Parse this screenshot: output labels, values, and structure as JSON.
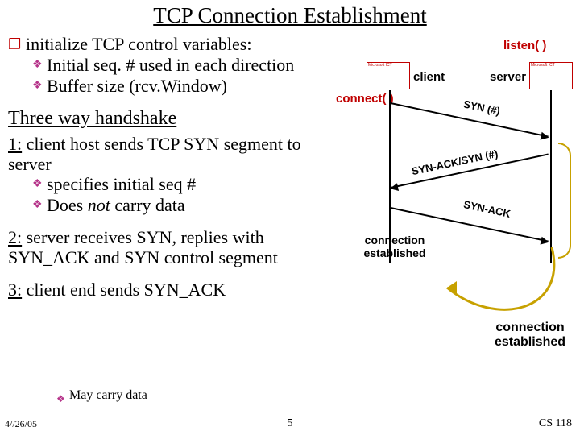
{
  "title": "TCP Connection Establishment",
  "init_block": {
    "top": "initialize TCP control variables:",
    "sub1": "Initial seq. # used in each direction",
    "sub2": "Buffer size (rcv.Window)"
  },
  "heading_twh": "Three way handshake",
  "step1": {
    "num": "1:",
    "line1": " client host sends TCP SYN segment to server",
    "sub_a": "specifies initial seq #",
    "sub_b_prefix": "Does ",
    "sub_b_italic": "not",
    "sub_b_suffix": " carry data"
  },
  "step2": {
    "num": "2:",
    "text": " server receives SYN, replies with SYN_ACK and SYN control segment"
  },
  "step3": {
    "num": "3:",
    "text": " client end sends SYN_ACK"
  },
  "may_carry": "May carry data",
  "diagram": {
    "listen": "listen( )",
    "client": "client",
    "server": "server",
    "connect": "connect( )",
    "missing_img": "Microsoft ICT",
    "arrow_syn": "SYN (#)",
    "arrow_synack": "SYN-ACK/SYN (#)",
    "arrow_synack2": "SYN-ACK",
    "conn_est_left": "connection\nestablished",
    "conn_est_right": "connection\nestablished"
  },
  "footer": {
    "date": "4//26/05",
    "page": "5",
    "course": "CS 118"
  },
  "chart_data": {
    "type": "sequence-diagram",
    "title": "TCP Three-way handshake",
    "actors": [
      "client",
      "server"
    ],
    "preconditions": {
      "server": "listen( )",
      "client": "connect( )"
    },
    "messages": [
      {
        "from": "client",
        "to": "server",
        "label": "SYN (#)"
      },
      {
        "from": "server",
        "to": "client",
        "label": "SYN-ACK/SYN (#)",
        "result_at_client": "connection established"
      },
      {
        "from": "client",
        "to": "server",
        "label": "SYN-ACK",
        "result_at_server": "connection established"
      }
    ]
  }
}
